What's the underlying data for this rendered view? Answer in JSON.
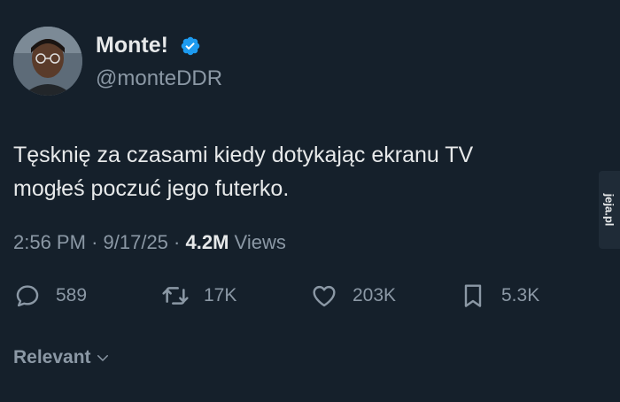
{
  "author": {
    "display_name": "Monte!",
    "handle": "@monteDDR",
    "avatar": "profile-photo",
    "verified_badge": "verified-check-icon",
    "verified_color": "#1d9bf0"
  },
  "tweet": {
    "line1": "Tęsknię za czasami kiedy dotykając ekranu TV",
    "line2": "mogłeś poczuć jego futerko."
  },
  "meta": {
    "time": "2:56 PM",
    "separator": "·",
    "date": "9/17/25",
    "views_count": "4.2M",
    "views_label": "Views"
  },
  "actions": {
    "replies": "589",
    "retweets": "17K",
    "likes": "203K",
    "bookmarks": "5.3K"
  },
  "sort": {
    "label": "Relevant"
  },
  "watermark": {
    "text": "jeja.pl"
  },
  "colors": {
    "background": "#15202b",
    "text_primary": "#e7e9ea",
    "text_secondary": "#8b98a5"
  }
}
